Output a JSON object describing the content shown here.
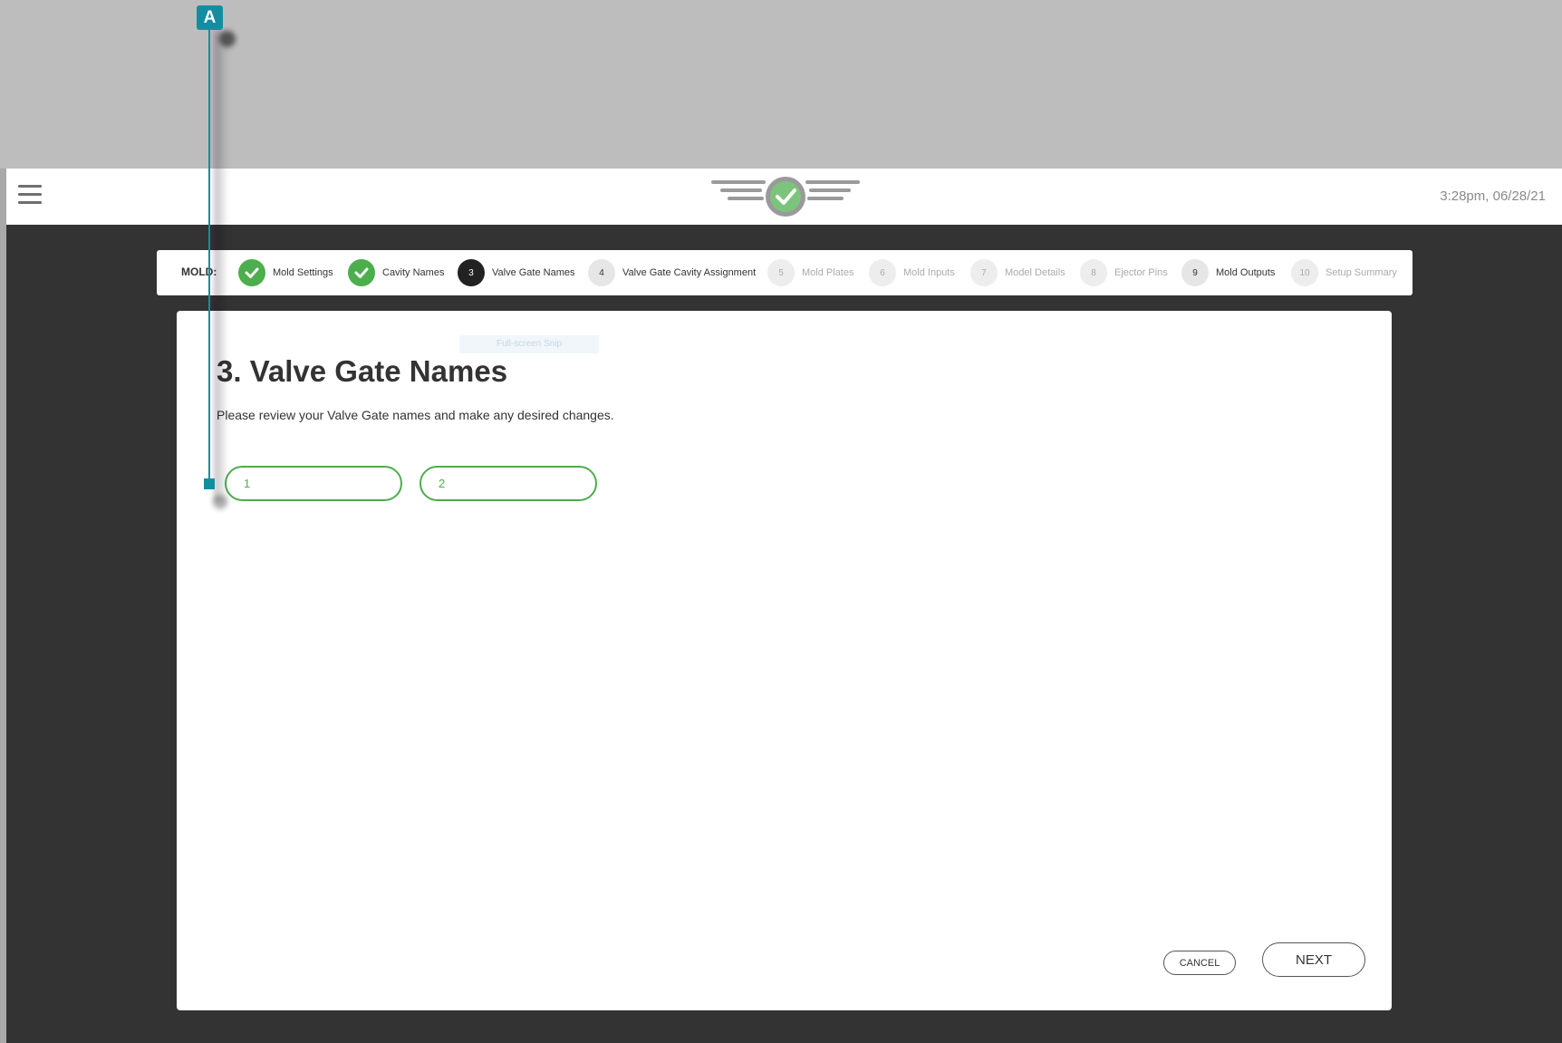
{
  "header": {
    "clock": "3:28pm, 06/28/21"
  },
  "stepper": {
    "prefix": "MOLD:",
    "steps": [
      {
        "number": "",
        "label": "Mold Settings",
        "state": "done"
      },
      {
        "number": "",
        "label": "Cavity Names",
        "state": "done"
      },
      {
        "number": "3",
        "label": "Valve Gate Names",
        "state": "current"
      },
      {
        "number": "4",
        "label": "Valve Gate Cavity Assignment",
        "state": "todo"
      },
      {
        "number": "5",
        "label": "Mold Plates",
        "state": "disabled"
      },
      {
        "number": "6",
        "label": "Mold Inputs",
        "state": "disabled"
      },
      {
        "number": "7",
        "label": "Model Details",
        "state": "disabled"
      },
      {
        "number": "8",
        "label": "Ejector Pins",
        "state": "disabled"
      },
      {
        "number": "9",
        "label": "Mold Outputs",
        "state": "todo"
      },
      {
        "number": "10",
        "label": "Setup Summary",
        "state": "disabled"
      }
    ]
  },
  "main": {
    "ghost_text": "Full-screen Snip",
    "title": "3. Valve Gate Names",
    "description": "Please review your Valve Gate names and make any desired changes.",
    "valve_gates": [
      {
        "value": "1"
      },
      {
        "value": "2"
      }
    ],
    "cancel_label": "CANCEL",
    "next_label": "NEXT"
  },
  "annotation": {
    "badge": "A",
    "color": "#138ea0"
  },
  "colors": {
    "accent_green": "#4cae4c",
    "dark_background": "#333333",
    "outer_background": "#bdbdbd"
  }
}
